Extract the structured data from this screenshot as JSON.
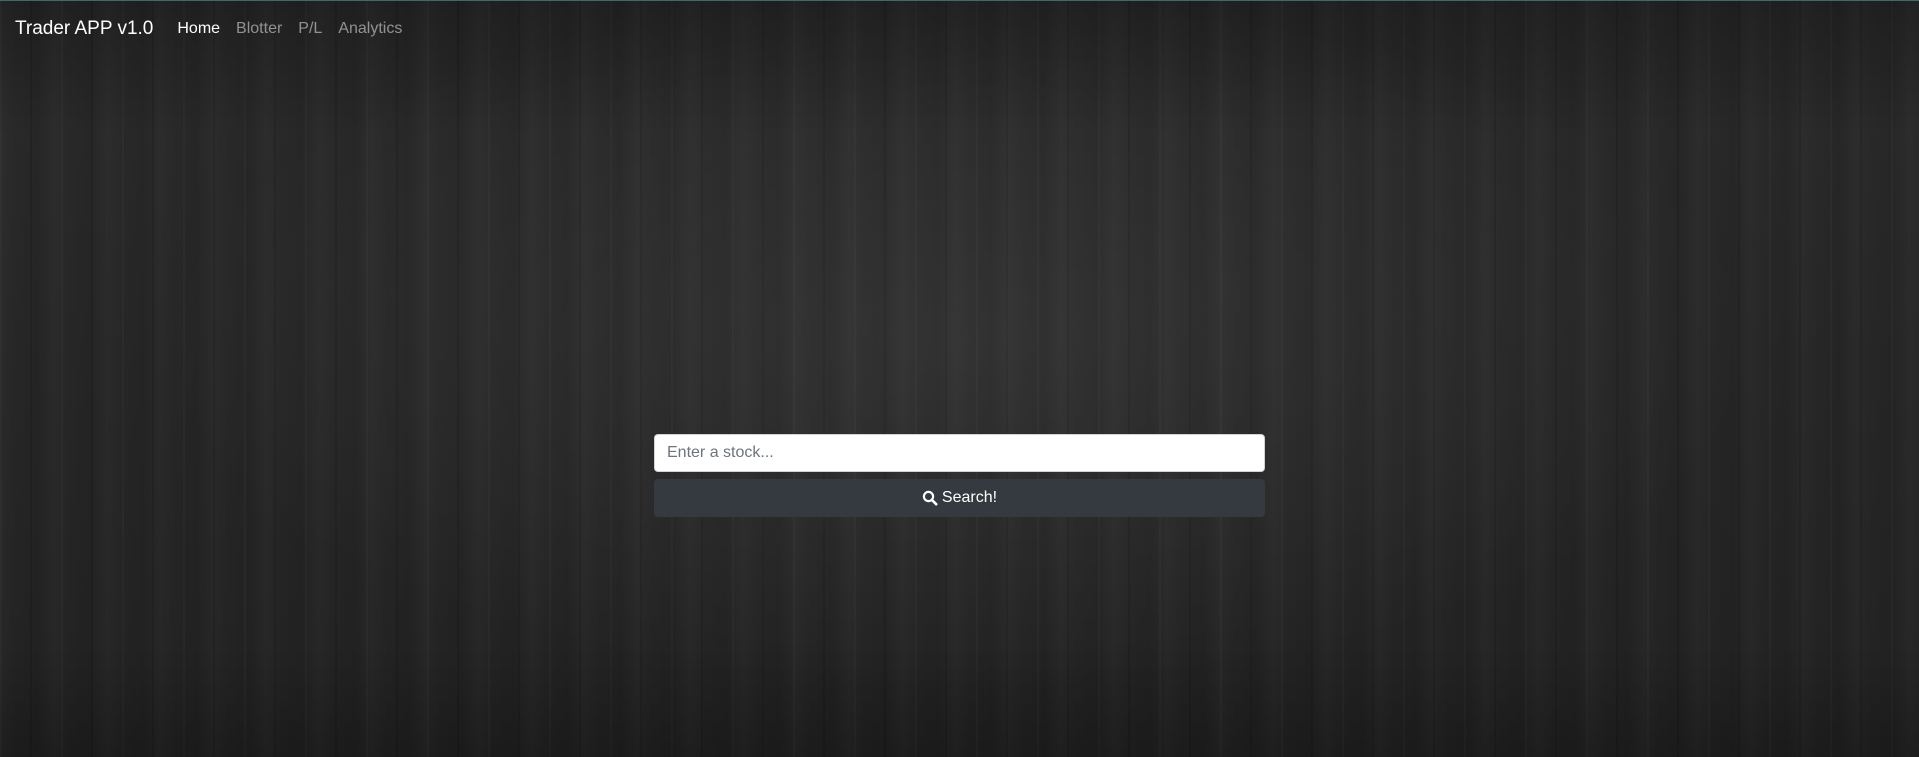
{
  "navbar": {
    "brand": "Trader APP v1.0",
    "items": [
      {
        "label": "Home",
        "active": true
      },
      {
        "label": "Blotter",
        "active": false
      },
      {
        "label": "P/L",
        "active": false
      },
      {
        "label": "Analytics",
        "active": false
      }
    ]
  },
  "search": {
    "placeholder": "Enter a stock...",
    "value": "",
    "button_label": "Search!",
    "icon": "search-icon"
  },
  "colors": {
    "navbar_accent": "#3c6b6b",
    "button_bg": "#343a40",
    "nav_inactive": "rgba(255,255,255,0.5)"
  }
}
